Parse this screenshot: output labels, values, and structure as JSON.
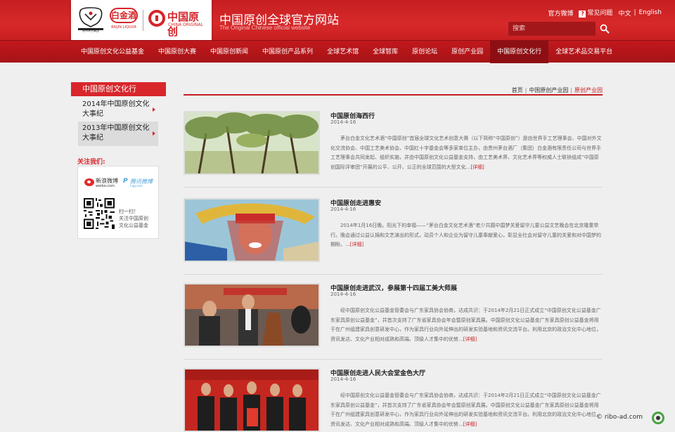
{
  "header": {
    "logo1_caption": "贵州茅台集团",
    "logo2_text": "白金酒",
    "logo2_caption": "BAIJIN LIQUOR",
    "logo3_cn": "中国原创",
    "logo3_en": "CHINA ORIGINAL",
    "site_title": "中国原创全球官方网站",
    "site_subtitle": "The Original Chinese official website",
    "links": {
      "weibo": "官方微博",
      "faq": "常见问题",
      "lang_cn": "中文",
      "lang_sep": "|",
      "lang_en": "English"
    },
    "search_placeholder": "搜索"
  },
  "nav": {
    "items": [
      {
        "label": "中国原创文化公益基金"
      },
      {
        "label": "中国原创大赛"
      },
      {
        "label": "中国原创新闻"
      },
      {
        "label": "中国原创产品系列"
      },
      {
        "label": "全球艺术馆"
      },
      {
        "label": "全球智库"
      },
      {
        "label": "原创论坛"
      },
      {
        "label": "原创产业园"
      },
      {
        "label": "中国原创文化行"
      },
      {
        "label": "全球艺术品交易平台"
      }
    ],
    "active_index": 8
  },
  "sidebar": {
    "title": "中国原创文化行",
    "items": [
      {
        "label_line1": "2014年中国原创文化",
        "label_line2": "大事纪"
      },
      {
        "label_line1": "2013年中国原创文化",
        "label_line2": "大事纪"
      }
    ],
    "follow_label": "关注我们:",
    "weibo_name": "新浪微博",
    "weibo_domain": "weibo.com",
    "tencent_name": "腾讯微博",
    "tencent_domain": "t.qq.com",
    "qr_text_1": "扫一扫！",
    "qr_text_2": "关注中国原创",
    "qr_text_3": "文化公益基金"
  },
  "breadcrumb": {
    "home": "首页",
    "sep": "|",
    "parent": "中国原创产业园",
    "current": "原创产业园"
  },
  "articles": [
    {
      "title": "中国原创海西行",
      "date": "2014-4-16",
      "body": "茅台白金文化艺术酒“中国原创”首届全球文化艺术创意大赛（以下简称“中国原创”）是由世界手工艺理事会、中国对外文化交流协会、中国工艺美术协会、中国红十字基金会等多家单位主办，由贵州茅台酒厂（集团）白金酒有限责任公司与世界手工艺理事会共同发起、组织实施，并由中国原创文化公益基金支持，由工艺美术界、文化艺术界等权威人士联袂组成“中国原创国际评审团”开展的公平、公开、公正的全球范围的大型文化...",
      "more": "[详细]"
    },
    {
      "title": "中国原创走进惠安",
      "date": "2014-4-16",
      "body": "2014年1月16日晚，阳光下的幸福——“茅台白金文化艺术酒”老少共圆中国梦关爱留守儿童公益文艺晚会在北京隆重举行。晚会通过公益认捐和文艺演出的形式，动员个人和企业为留守儿童奉献爱心，彰显全社会对留守儿童的关爱和对中国梦的期盼。...",
      "more": "[详细]"
    },
    {
      "title": "中国原创走进武汉，参展第十四届工美大师展",
      "date": "2014-4-16",
      "body": "经中国原创文化公益基金管委会与广东家具协会协商，达成共识：于2014年2月21日正式成立“中国原创文化公益基金广东家具原创公益基金”，并首次支持了广东省家具协会年会暨原创家具展。中国原创文化公益基金广东家具原创公益基金将用于在广州组建家具创意研发中心，作为家具行业向外延伸出的研发实验基地和资讯交流平台。利用北京的政治文化中心地位，资讯发达、文化产业相对成熟和高端、顶级人才集中的优势...",
      "more": "[详细]"
    },
    {
      "title": "中国原创走进人民大会堂金色大厅",
      "date": "2014-4-16",
      "body": "经中国原创文化公益基金管委会与广东家具协会协商，达成共识：于2014年2月21日正式成立“中国原创文化公益基金广东家具原创公益基金”，并首次支持了广东省家具协会年会暨原创家具展。中国原创文化公益基金广东家具原创公益基金将用于在广州组建家具创意研发中心，作为家具行业向外延伸出的研发实验基地和资讯交流平台。利用北京的政治文化中心地位，资讯发达、文化产业相对成熟和高端、顶级人才集中的优势...",
      "more": "[详细]"
    }
  ],
  "watermark": "© ribo-ad.com"
}
